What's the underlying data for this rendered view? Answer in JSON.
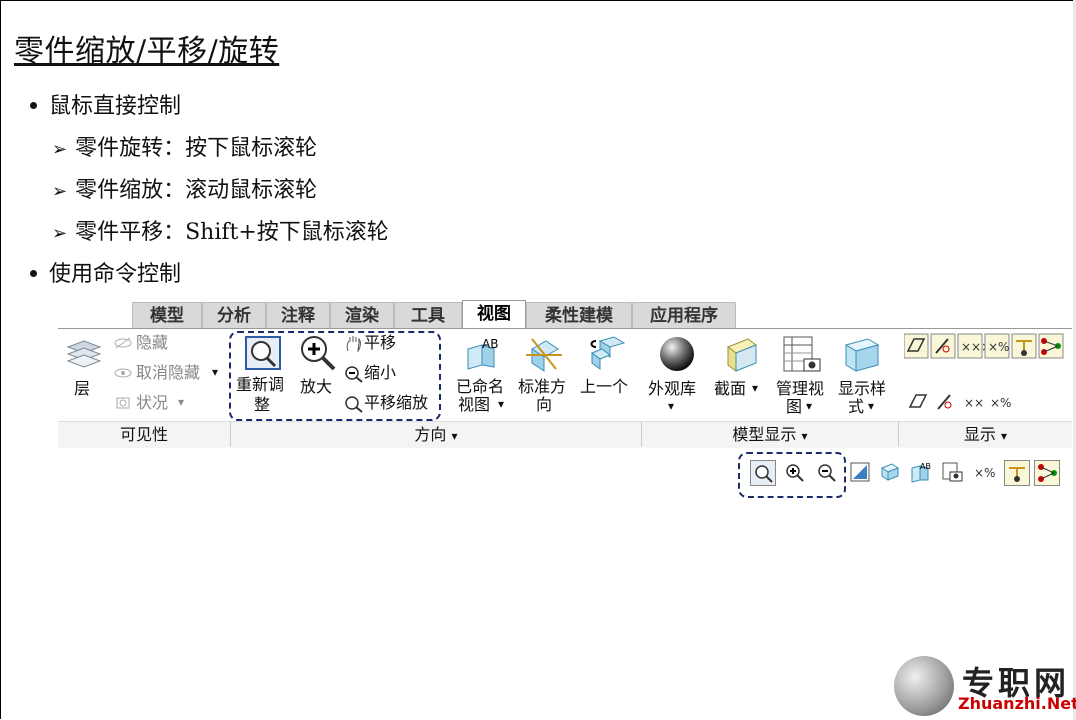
{
  "slide": {
    "title": "零件缩放/平移/旋转",
    "bullets": [
      {
        "level": 1,
        "text": "鼠标直接控制"
      },
      {
        "level": 2,
        "text": "零件旋转：按下鼠标滚轮"
      },
      {
        "level": 2,
        "text": "零件缩放：滚动鼠标滚轮"
      },
      {
        "level": 2,
        "text": "零件平移：Shift+按下鼠标滚轮"
      },
      {
        "level": 1,
        "text": "使用命令控制"
      }
    ]
  },
  "ribbon": {
    "tabs": [
      "模型",
      "分析",
      "注释",
      "渲染",
      "工具",
      "视图",
      "柔性建模",
      "应用程序"
    ],
    "active_tab": "视图",
    "visibility": {
      "layer_label": "层",
      "hide_label": "隐藏",
      "unhide_label": "取消隐藏",
      "status_label": "状况",
      "group_label": "可见性"
    },
    "orientation": {
      "refit_label_1": "重新调",
      "refit_label_2": "整",
      "zoom_in_label": "放大",
      "pan_label": "平移",
      "zoom_out_label": "缩小",
      "pan_zoom_label": "平移缩放",
      "named_view_label_1": "已命名",
      "named_view_label_2": "视图",
      "standard_label_1": "标准方",
      "standard_label_2": "向",
      "previous_label": "上一个",
      "group_label": "方向"
    },
    "model_display": {
      "appearance_label": "外观库",
      "section_label": "截面",
      "manage_views_label_1": "管理视",
      "manage_views_label_2": "图",
      "display_style_label_1": "显示样",
      "display_style_label_2": "式",
      "group_label": "模型显示"
    },
    "show": {
      "group_label": "显示"
    },
    "dropdown_glyph": "▾"
  },
  "logo": {
    "cn": "专职网",
    "en": "Zhuanzhi.Net"
  },
  "colors": {
    "dash_outline": "#1a2a6a",
    "accent_blue": "#2a5ba8",
    "logo_red": "#cc0000"
  }
}
